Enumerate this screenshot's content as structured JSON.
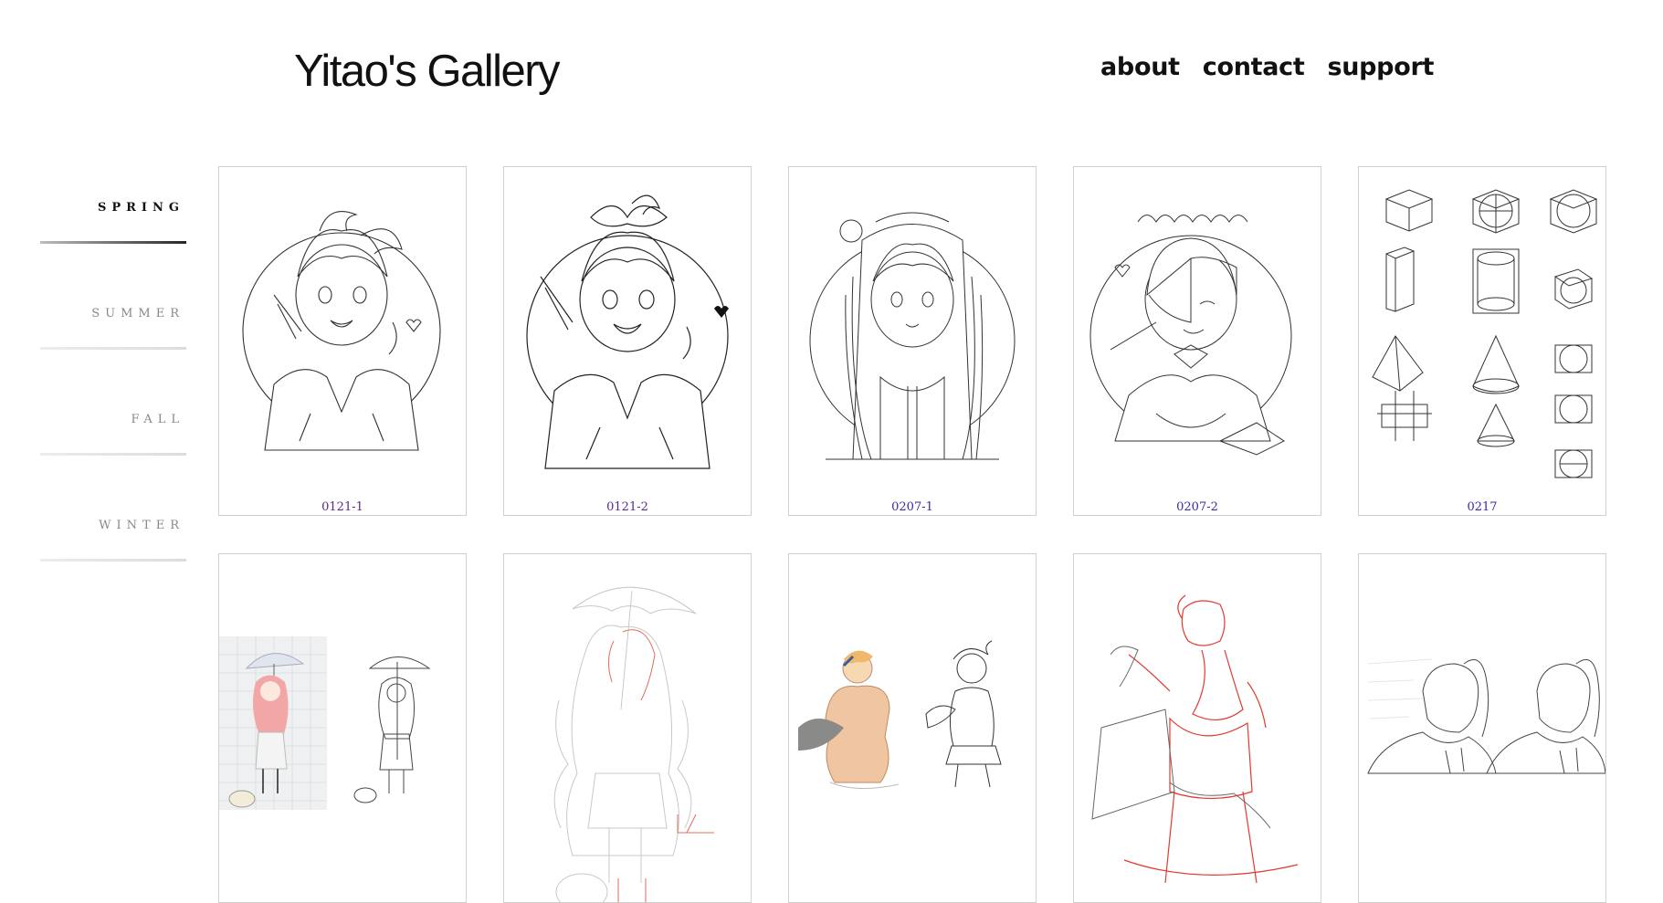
{
  "header": {
    "title": "Yitao's Gallery",
    "nav": [
      {
        "label": "about"
      },
      {
        "label": "contact"
      },
      {
        "label": "support"
      }
    ]
  },
  "seasons": [
    {
      "label": "SPRING",
      "active": true
    },
    {
      "label": "SUMMER",
      "active": false
    },
    {
      "label": "FALL",
      "active": false
    },
    {
      "label": "WINTER",
      "active": false
    }
  ],
  "gallery": {
    "row1": [
      {
        "caption": "0121-1",
        "subject": "girl-sketch-ahoge"
      },
      {
        "caption": "0121-2",
        "subject": "girl-sketch-bow"
      },
      {
        "caption": "0207-1",
        "subject": "girl-sketch-flower"
      },
      {
        "caption": "0207-2",
        "subject": "maid-sketch"
      },
      {
        "caption": "0217",
        "subject": "geometric-forms-sketch"
      }
    ],
    "row2": [
      {
        "subject": "umbrella-girl-reference"
      },
      {
        "subject": "umbrella-girl-sketch"
      },
      {
        "subject": "wading-girl-reference"
      },
      {
        "subject": "red-line-figure-sketch"
      },
      {
        "subject": "ponytail-portrait-sketch"
      }
    ]
  },
  "colors": {
    "link": "#3a2aa6",
    "visited_link": "#5a2a8a",
    "card_border": "#cfcfcf",
    "sketch_red": "#e03a2f"
  }
}
